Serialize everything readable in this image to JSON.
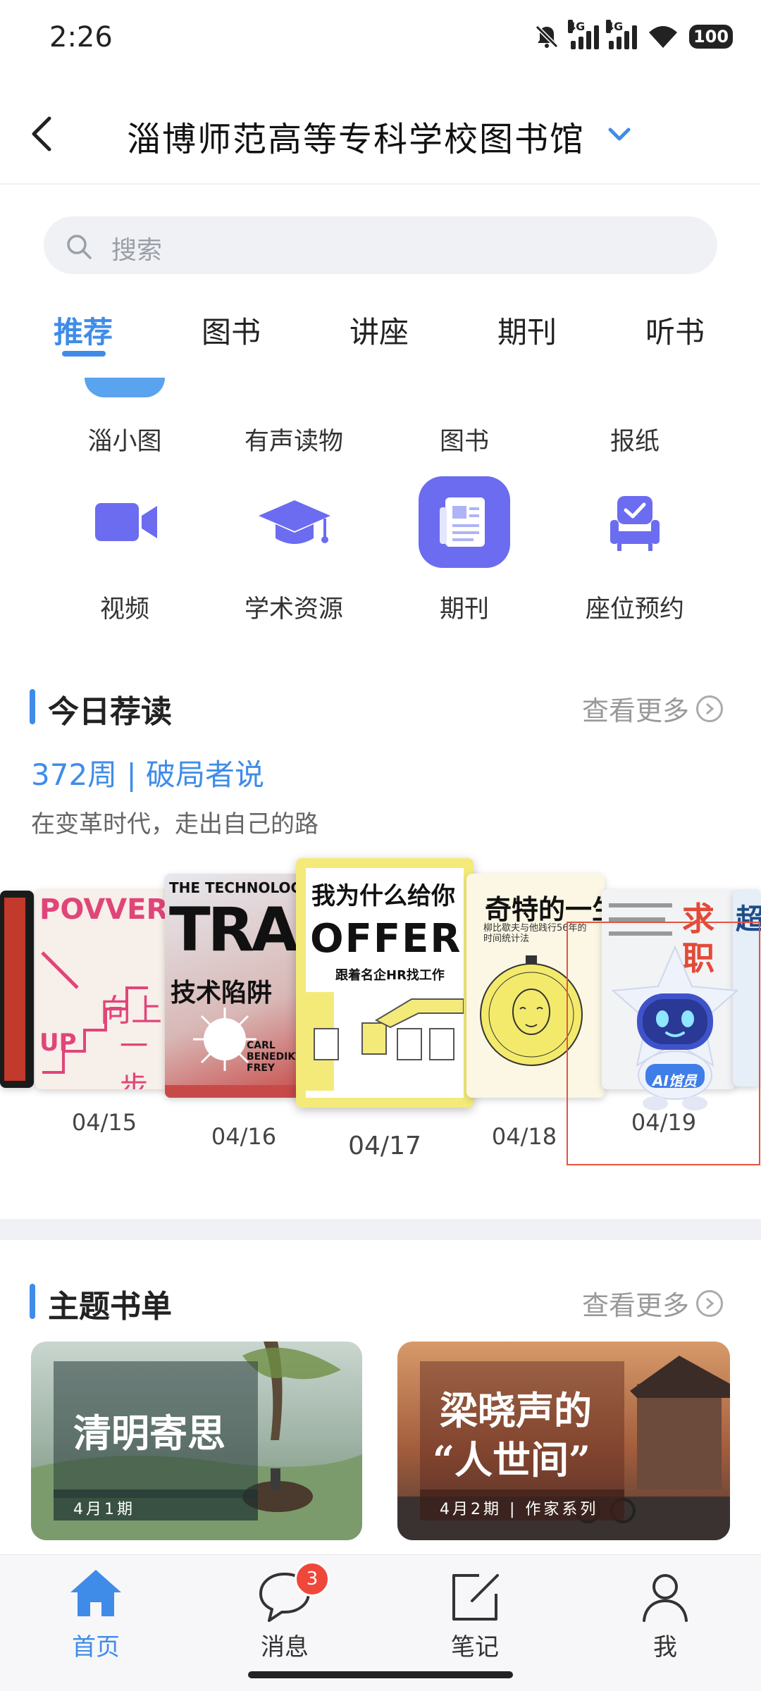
{
  "status_bar": {
    "time": "2:26",
    "battery": "100",
    "signal_label": "4G",
    "icons": [
      "bell-off-icon",
      "signal-icon",
      "signal-icon",
      "wifi-icon",
      "battery-icon"
    ]
  },
  "header": {
    "title": "淄博师范高等专科学校图书馆"
  },
  "search": {
    "placeholder": "搜索"
  },
  "tabs": [
    {
      "label": "推荐",
      "active": true
    },
    {
      "label": "图书"
    },
    {
      "label": "讲座"
    },
    {
      "label": "期刊"
    },
    {
      "label": "听书"
    }
  ],
  "shortcuts_row1": [
    {
      "label": "淄小图"
    },
    {
      "label": "有声读物"
    },
    {
      "label": "图书"
    },
    {
      "label": "报纸"
    }
  ],
  "shortcuts_row2": [
    {
      "label": "视频",
      "icon": "video-icon"
    },
    {
      "label": "学术资源",
      "icon": "graduation-cap-icon"
    },
    {
      "label": "期刊",
      "icon": "journal-icon"
    },
    {
      "label": "座位预约",
      "icon": "seat-reservation-icon"
    }
  ],
  "today_read": {
    "title": "今日荐读",
    "more": "查看更多",
    "week": "372周 | 破局者说",
    "subtitle": "在变革时代，走出自己的路",
    "books": [
      {
        "date": "04/15",
        "cover_text": [
          "POVVER",
          "向上",
          "一步",
          "UP"
        ]
      },
      {
        "date": "04/16",
        "cover_text": [
          "THE TECHNOLOGY",
          "TRA",
          "技术陷阱",
          "CARL BENEDIKT FREY"
        ]
      },
      {
        "date": "04/17",
        "cover_text": [
          "我为什么给你",
          "OFFER",
          "跟着名企HR找工作"
        ]
      },
      {
        "date": "04/18",
        "cover_text": [
          "奇特的一生",
          "柳比歇夫与他践行56年的时间统计法"
        ]
      },
      {
        "date": "04/19",
        "cover_text": [
          "求职",
          "AI馆员"
        ]
      }
    ],
    "edge_cover_text": "超"
  },
  "theme_list": {
    "title": "主题书单",
    "more": "查看更多",
    "cards": [
      {
        "title": "清明寄思",
        "tag": "4月1期"
      },
      {
        "title_line1": "梁晓声的",
        "title_line2": "“人世间”",
        "tag": "4月2期 | 作家系列"
      }
    ]
  },
  "bottom_nav": [
    {
      "label": "首页",
      "active": true
    },
    {
      "label": "消息",
      "badge": "3"
    },
    {
      "label": "笔记"
    },
    {
      "label": "我"
    }
  ],
  "colors": {
    "accent": "#3f8ce8",
    "icon_purple": "#6b6cf0",
    "badge": "#f0473b"
  }
}
